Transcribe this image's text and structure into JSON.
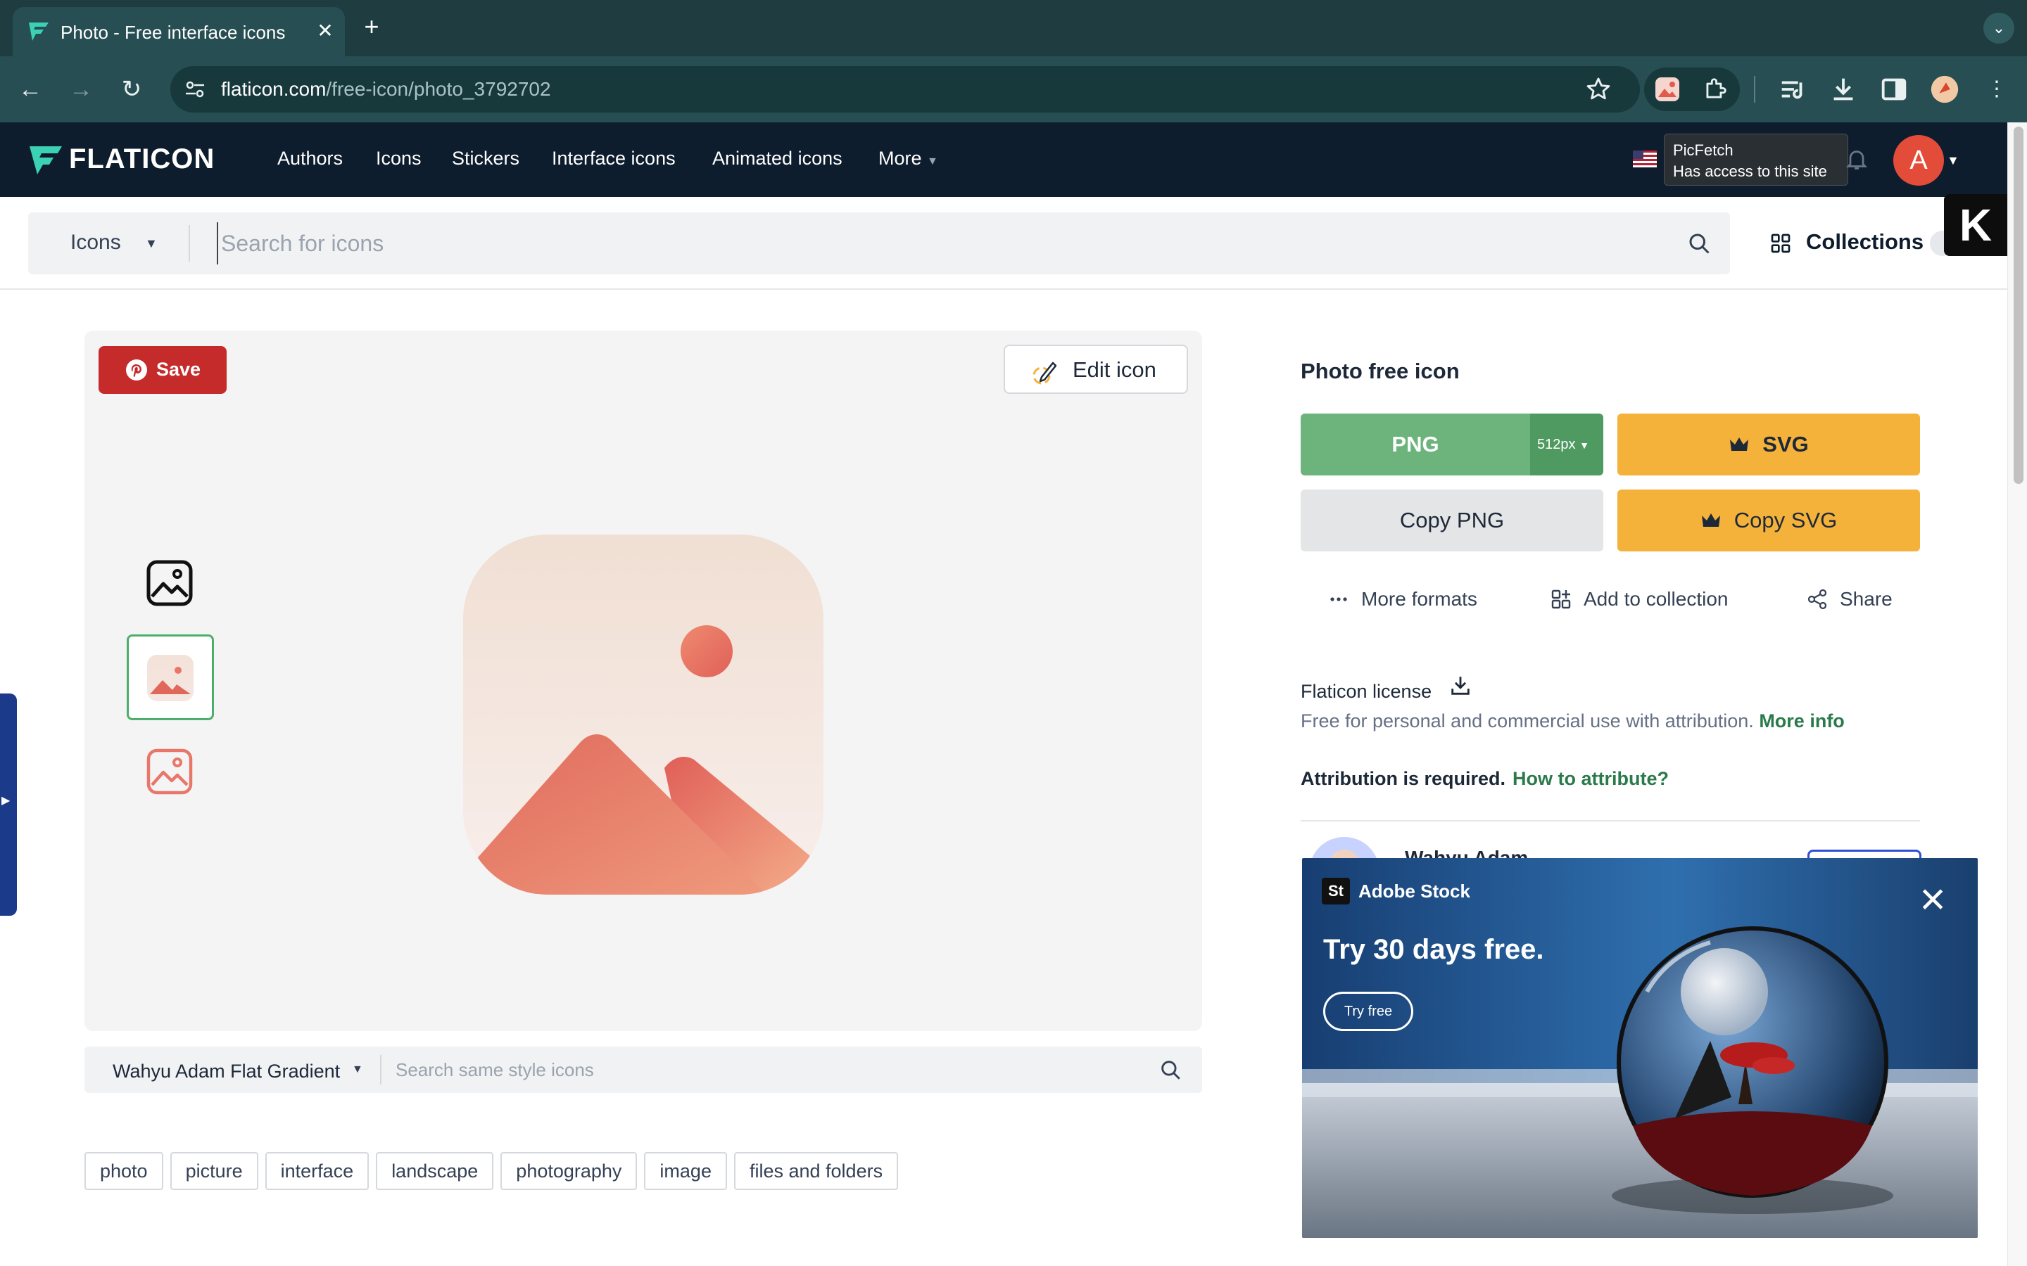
{
  "browser": {
    "tab_title": "Photo - Free interface icons",
    "url_host": "flaticon.com",
    "url_path": "/free-icon/photo_3792702"
  },
  "header": {
    "logo": "FLATICON",
    "nav": [
      "Authors",
      "Icons",
      "Stickers",
      "Interface icons",
      "Animated icons",
      "More"
    ],
    "tooltip_title": "PicFetch",
    "tooltip_sub": "Has access to this site",
    "avatar_letter": "A"
  },
  "search": {
    "type": "Icons",
    "placeholder": "Search for icons",
    "collections_label": "Collections"
  },
  "preview": {
    "save_label": "Save",
    "edit_label": "Edit icon",
    "style_name": "Wahyu Adam Flat Gradient",
    "style_placeholder": "Search same style icons"
  },
  "tags": [
    "photo",
    "picture",
    "interface",
    "landscape",
    "photography",
    "image",
    "files and folders"
  ],
  "download": {
    "title": "Photo free icon",
    "png_label": "PNG",
    "png_size": "512px",
    "svg_label": "SVG",
    "copy_png_label": "Copy PNG",
    "copy_svg_label": "Copy SVG",
    "more_formats": "More formats",
    "add_collection": "Add to collection",
    "share": "Share"
  },
  "license": {
    "title": "Flaticon license",
    "text": "Free for personal and commercial use with attribution.",
    "more_info": "More info",
    "attribution_required": "Attribution is required.",
    "how_to_attribute": "How to attribute?"
  },
  "author": {
    "name": "Wahyu Adam"
  },
  "ad": {
    "logo": "St",
    "brand": "Adobe Stock",
    "headline": "Try 30 days free.",
    "cta": "Try free"
  },
  "colors": {
    "brand_dark": "#0e1d2e",
    "png_green": "#6cb47c",
    "premium_yellow": "#f4b23a",
    "pinterest_red": "#c62b2b"
  }
}
